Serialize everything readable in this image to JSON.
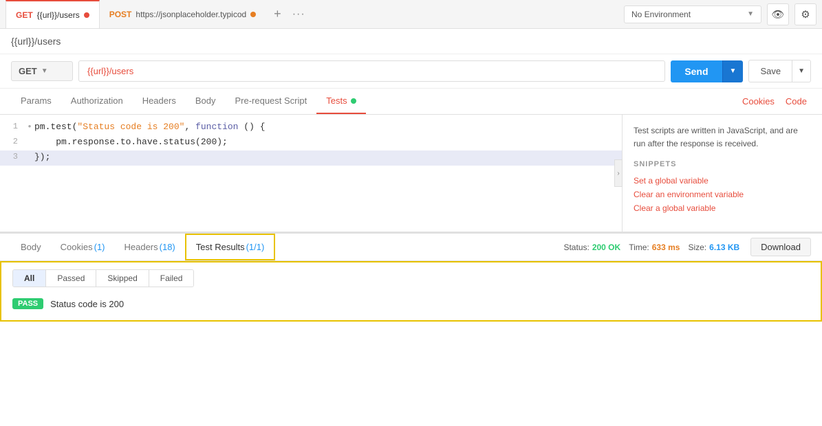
{
  "tabs": [
    {
      "id": "get-users",
      "method": "GET",
      "method_color": "#e74c3c",
      "url": "{{url}}/users",
      "dot_color": "red",
      "active": true
    },
    {
      "id": "post-jsonplaceholder",
      "method": "POST",
      "method_color": "#e67e22",
      "url": "https://jsonplaceholder.typicod",
      "dot_color": "orange",
      "active": false
    }
  ],
  "tab_actions": {
    "add": "+",
    "more": "···"
  },
  "env": {
    "label": "No Environment",
    "eye_icon": "👁",
    "gear_icon": "⚙"
  },
  "request_title": "{{url}}/users",
  "url_bar": {
    "method": "GET",
    "url": "{{url}}/users",
    "send_label": "Send",
    "save_label": "Save"
  },
  "request_tabs": [
    {
      "id": "params",
      "label": "Params",
      "active": false
    },
    {
      "id": "authorization",
      "label": "Authorization",
      "active": false
    },
    {
      "id": "headers",
      "label": "Headers",
      "active": false
    },
    {
      "id": "body",
      "label": "Body",
      "active": false
    },
    {
      "id": "pre-request",
      "label": "Pre-request Script",
      "active": false
    },
    {
      "id": "tests",
      "label": "Tests",
      "active": true,
      "has_dot": true
    }
  ],
  "right_links": {
    "cookies": "Cookies",
    "code": "Code"
  },
  "code_lines": [
    {
      "num": "1",
      "dot": "•",
      "code_parts": [
        {
          "text": "pm.test(",
          "class": "c-dark"
        },
        {
          "text": "\"Status code is 200\"",
          "class": "c-orange"
        },
        {
          "text": ", ",
          "class": "c-dark"
        },
        {
          "text": "function",
          "class": "c-blue"
        },
        {
          "text": " () {",
          "class": "c-dark"
        }
      ]
    },
    {
      "num": "2",
      "dot": "",
      "indent": "    ",
      "code_parts": [
        {
          "text": "pm.response.to.have.status(200);",
          "class": "c-dark"
        }
      ]
    },
    {
      "num": "3",
      "dot": "",
      "code_parts": [
        {
          "text": "});",
          "class": "c-dark"
        }
      ],
      "highlighted": true
    }
  ],
  "snippets": {
    "title": "SNIPPETS",
    "description": "Test scripts are written in JavaScript, and are run after the response is received.",
    "links": [
      "Set a global variable",
      "Clear an environment variable",
      "Clear a global variable"
    ]
  },
  "bottom_tabs": [
    {
      "id": "body",
      "label": "Body",
      "active": false
    },
    {
      "id": "cookies",
      "label": "Cookies",
      "badge": "(1)",
      "active": false
    },
    {
      "id": "headers",
      "label": "Headers",
      "badge": "(18)",
      "active": false
    },
    {
      "id": "test-results",
      "label": "Test Results",
      "badge": "(1/1)",
      "active": true
    }
  ],
  "status_bar": {
    "label_status": "Status:",
    "status_value": "200 OK",
    "label_time": "Time:",
    "time_value": "633 ms",
    "label_size": "Size:",
    "size_value": "6.13 KB",
    "download_label": "Download"
  },
  "filter_tabs": [
    {
      "id": "all",
      "label": "All",
      "active": true
    },
    {
      "id": "passed",
      "label": "Passed",
      "active": false
    },
    {
      "id": "skipped",
      "label": "Skipped",
      "active": false
    },
    {
      "id": "failed",
      "label": "Failed",
      "active": false
    }
  ],
  "test_rows": [
    {
      "badge": "PASS",
      "name": "Status code is 200"
    }
  ]
}
